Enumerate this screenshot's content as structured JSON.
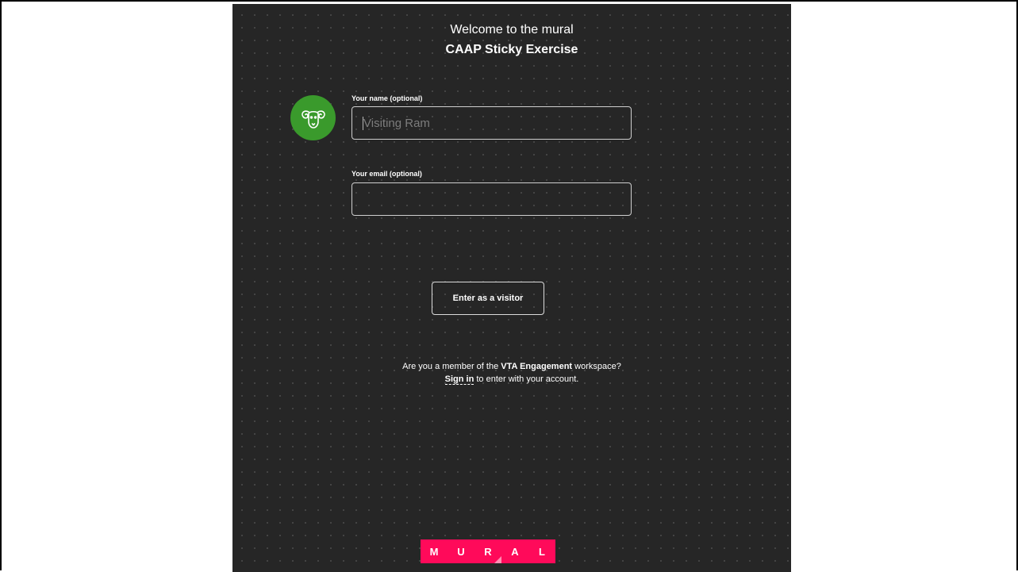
{
  "header": {
    "welcome": "Welcome to the mural",
    "mural_name": "CAAP Sticky Exercise"
  },
  "avatar": {
    "icon": "ram-icon",
    "color": "#3a9a2c"
  },
  "form": {
    "name_label": "Your name (optional)",
    "name_placeholder": "Visiting Ram",
    "name_value": "",
    "email_label": "Your email (optional)",
    "email_placeholder": "",
    "email_value": ""
  },
  "actions": {
    "enter_visitor": "Enter as a visitor"
  },
  "member_prompt": {
    "before": "Are you a member of the ",
    "workspace": "VTA Engagement",
    "after": " workspace?",
    "sign_in": "Sign in",
    "sign_in_suffix": " to enter with your account."
  },
  "logo": {
    "letters": [
      "M",
      "U",
      "R",
      "A",
      "L"
    ],
    "color": "#ff0a5a"
  },
  "colors": {
    "panel_background": "#262626",
    "page_background": "#ffffff"
  }
}
